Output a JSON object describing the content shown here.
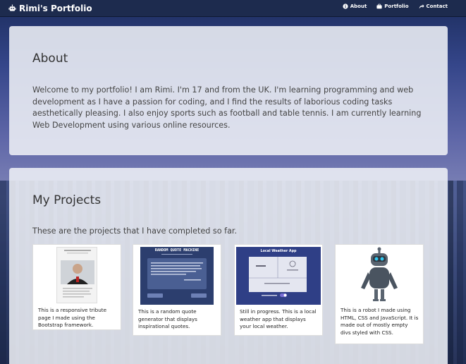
{
  "brand": {
    "title": "Rimi's Portfolio",
    "icon": "robot-icon"
  },
  "nav": [
    {
      "label": "About",
      "icon": "info-icon"
    },
    {
      "label": "Portfolio",
      "icon": "briefcase-icon"
    },
    {
      "label": "Contact",
      "icon": "share-icon"
    }
  ],
  "about": {
    "heading": "About",
    "text": "Welcome to my portfolio! I am Rimi. I'm 17 and from the UK. I'm learning programming and web development as I have a passion for coding, and I find the results of laborious coding tasks aesthetically pleasing. I also enjoy sports such as football and table tennis. I am currently learning Web Development using various online resources."
  },
  "projects": {
    "heading": "My Projects",
    "intro": "These are the projects that I have completed so far.",
    "items": [
      {
        "description": "This is a responsive tribute page I made using the Bootstrap framework.",
        "thumb": "tribute-page-thumbnail"
      },
      {
        "description": "This is a random quote generator that displays inspirational quotes.",
        "thumb": "quote-machine-thumbnail",
        "thumb_title": "RANDOM QUOTE MACHINE"
      },
      {
        "description": "Still in progress. This is a local weather app that displays your local weather.",
        "thumb": "weather-app-thumbnail",
        "thumb_title": "Local Weather App"
      },
      {
        "description": "This is a robot I made using HTML, CSS and JavaScript. It is made out of mostly empty divs styled with CSS.",
        "thumb": "robot-thumbnail"
      }
    ]
  },
  "colors": {
    "navbar": "#1d2b4e",
    "panel": "#eef0f6",
    "text": "#444444"
  }
}
